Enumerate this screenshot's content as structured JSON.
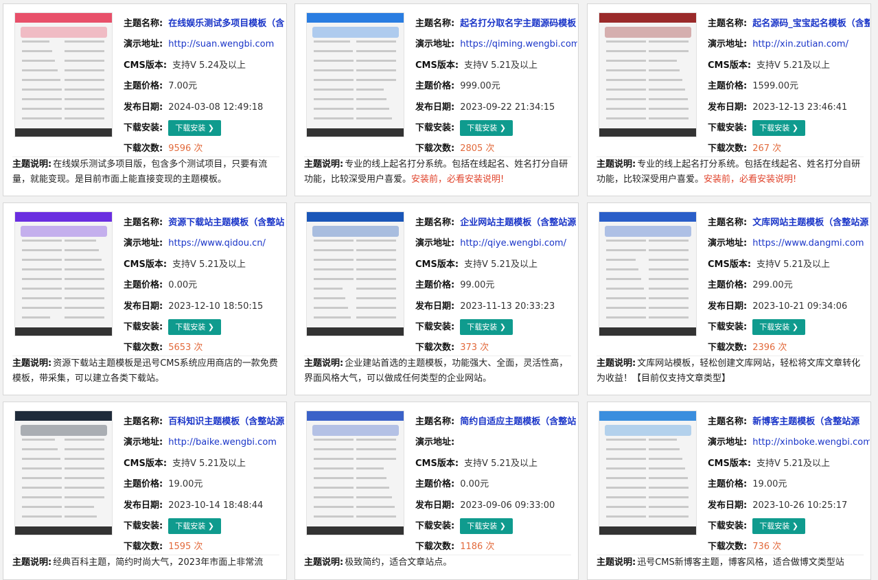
{
  "labels": {
    "name": "主题名称:",
    "demo": "演示地址:",
    "cms": "CMS版本:",
    "price": "主题价格:",
    "date": "发布日期:",
    "install": "下载安装:",
    "downloads": "下载次数:",
    "desc": "主题说明:",
    "button": "下载安装 ❯",
    "times_suffix": " 次"
  },
  "cards": [
    {
      "name": "在线娱乐测试多项目模板（含",
      "demo": "http://suan.wengbi.com",
      "cms": "支持V 5.24及以上",
      "price": "7.00元",
      "date": "2024-03-08 12:49:18",
      "downloads": "9596 次",
      "desc": "在线娱乐测试多项目版，包含多个测试项目，只要有流量，就能变现。是目前市面上能直接变现的主题模板。",
      "warn": ""
    },
    {
      "name": "起名打分取名字主题源码模板",
      "demo": "https://qiming.wengbi.com",
      "cms": "支持V 5.21及以上",
      "price": "999.00元",
      "date": "2023-09-22 21:34:15",
      "downloads": "2805 次",
      "desc": "专业的线上起名打分系统。包括在线起名、姓名打分自研功能，比较深受用户喜爱。",
      "warn": "安装前，必看安装说明!"
    },
    {
      "name": "起名源码_宝宝起名模板（含整",
      "demo": "http://xin.zutian.com/",
      "cms": "支持V 5.21及以上",
      "price": "1599.00元",
      "date": "2023-12-13 23:46:41",
      "downloads": "267 次",
      "desc": "专业的线上起名打分系统。包括在线起名、姓名打分自研功能，比较深受用户喜爱。",
      "warn": "安装前，必看安装说明!"
    },
    {
      "name": "资源下载站主题模板（含整站",
      "demo": "https://www.qidou.cn/",
      "cms": "支持V 5.21及以上",
      "price": "0.00元",
      "date": "2023-12-10 18:50:15",
      "downloads": "5653 次",
      "desc": "资源下载站主题模板是迅号CMS系统应用商店的一款免费模板，带采集，可以建立各类下载站。",
      "warn": ""
    },
    {
      "name": "企业网站主题模板（含整站源",
      "demo": "http://qiye.wengbi.com/",
      "cms": "支持V 5.21及以上",
      "price": "99.00元",
      "date": "2023-11-13 20:33:23",
      "downloads": "373 次",
      "desc": "企业建站首选的主题模板，功能强大、全面，灵活性高，界面风格大气，可以做成任何类型的企业网站。",
      "warn": ""
    },
    {
      "name": "文库网站主题模板（含整站源",
      "demo": "https://www.dangmi.com",
      "cms": "支持V 5.21及以上",
      "price": "299.00元",
      "date": "2023-10-21 09:34:06",
      "downloads": "2396 次",
      "desc": "文库网站模板，轻松创建文库网站，轻松将文库文章转化为收益！【目前仅支持文章类型】",
      "warn": ""
    },
    {
      "name": "百科知识主题模板（含整站源",
      "demo": "http://baike.wengbi.com",
      "cms": "支持V 5.21及以上",
      "price": "19.00元",
      "date": "2023-10-14 18:48:44",
      "downloads": "1595 次",
      "desc": "经典百科主题，简约时尚大气，2023年市面上非常流",
      "warn": ""
    },
    {
      "name": "简约自适应主题模板（含整站",
      "demo": "",
      "cms": "支持V 5.21及以上",
      "price": "0.00元",
      "date": "2023-09-06 09:33:00",
      "downloads": "1186 次",
      "desc": "极致简约，适合文章站点。",
      "warn": ""
    },
    {
      "name": "新博客主题模板（含整站源",
      "demo": "http://xinboke.wengbi.com/",
      "cms": "支持V 5.21及以上",
      "price": "19.00元",
      "date": "2023-10-26 10:25:17",
      "downloads": "736 次",
      "desc": "迅号CMS新博客主题，博客风格，适合做博文类型站",
      "warn": ""
    }
  ],
  "thumb_colors": [
    "#e8506a",
    "#2a7de1",
    "#9a2a2a",
    "#6a2ee0",
    "#1a56b8",
    "#2a5ec8",
    "#1f2b3a",
    "#3b62c8",
    "#3a8ede"
  ]
}
